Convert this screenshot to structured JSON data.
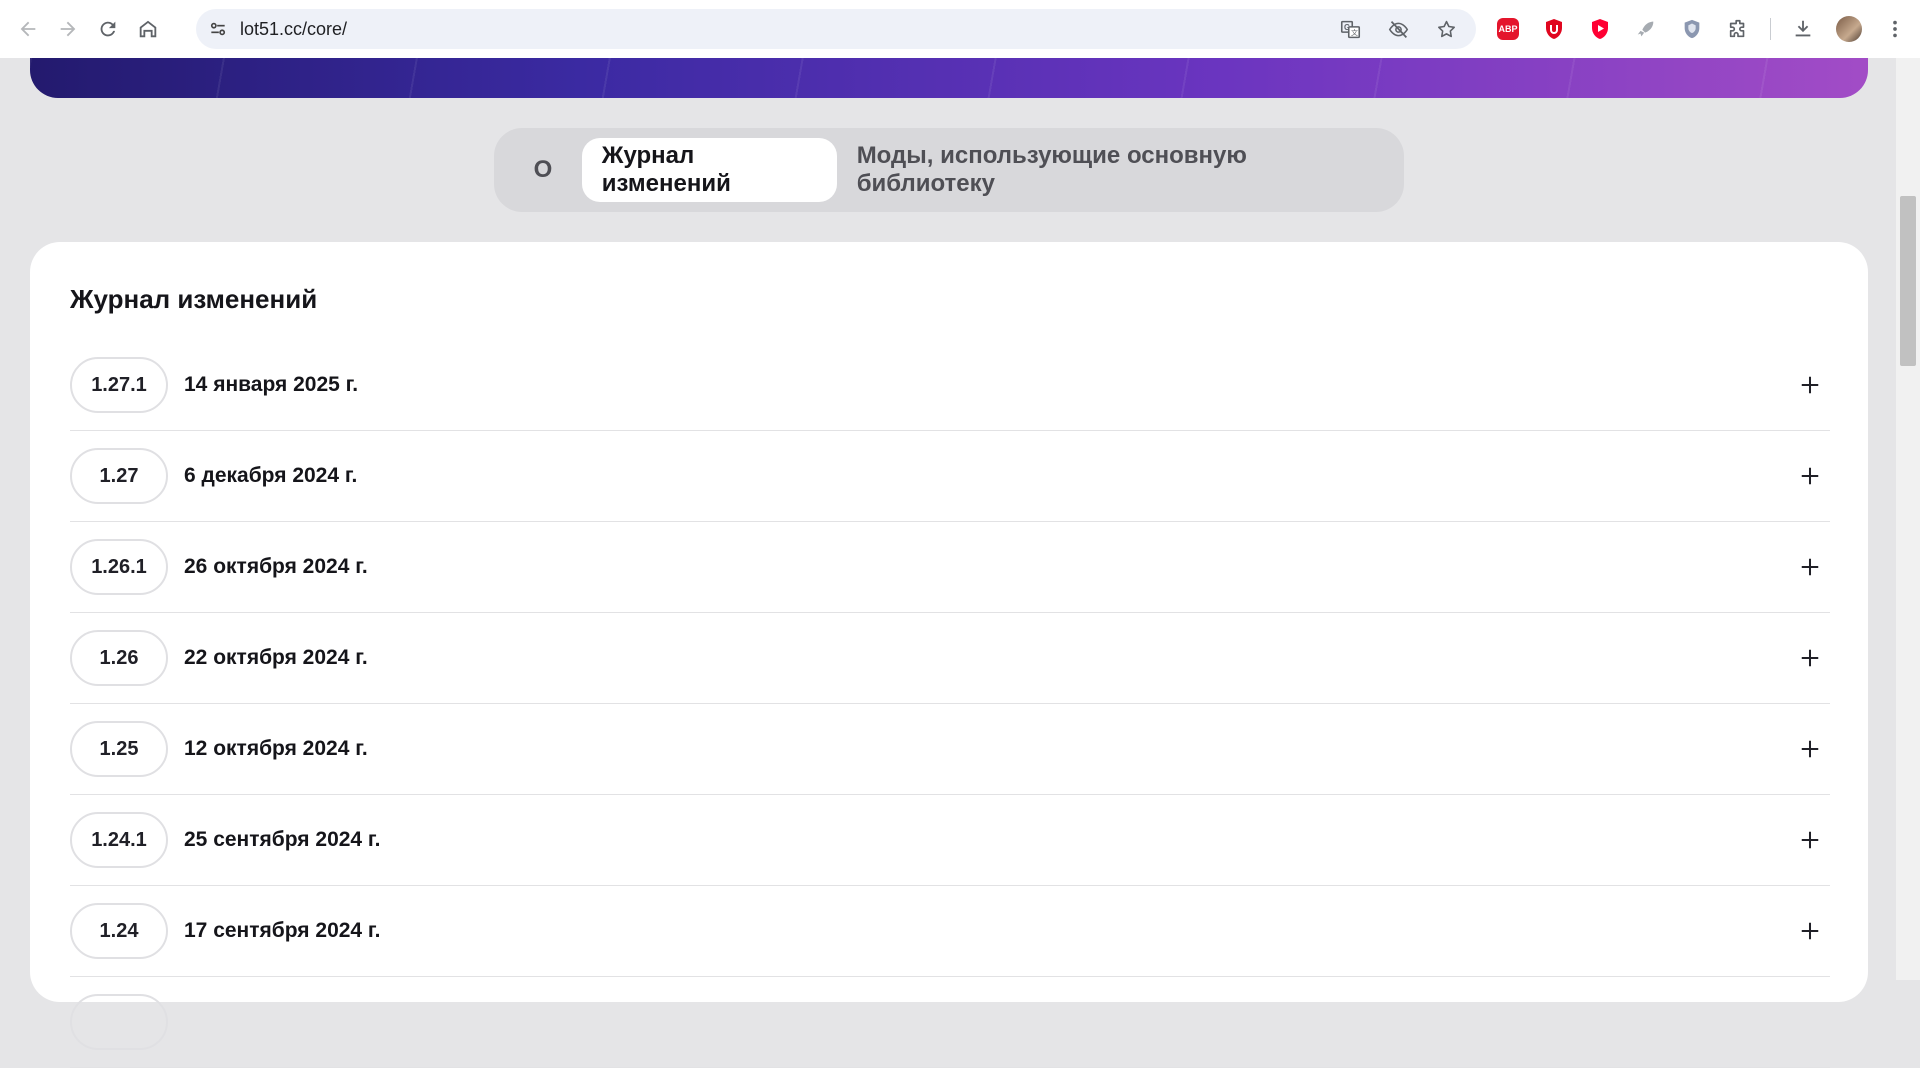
{
  "browser": {
    "url": "lot51.cc/core/",
    "icons": [
      "back-arrow-icon",
      "forward-arrow-icon",
      "reload-icon",
      "home-icon",
      "site-settings-icon",
      "translate-icon",
      "eye-off-icon",
      "star-icon",
      "extensions-icon",
      "download-icon"
    ],
    "extensions": [
      {
        "name": "adblock-plus",
        "label": "ABP",
        "color": "#e4152c"
      },
      {
        "name": "ublock",
        "label": "",
        "color": "#e0061f"
      },
      {
        "name": "youtube",
        "label": "",
        "color": "#ff0033"
      },
      {
        "name": "rocket",
        "label": "",
        "color": "#9ea3a8"
      },
      {
        "name": "shield",
        "label": "",
        "color": "#8b97b0"
      }
    ]
  },
  "tabs": {
    "about": "О",
    "changelog": "Журнал изменений",
    "mods": "Моды, использующие основную библиотеку"
  },
  "changelog": {
    "title": "Журнал изменений",
    "entries": [
      {
        "version": "1.27.1",
        "date": "14 января 2025 г."
      },
      {
        "version": "1.27",
        "date": "6 декабря 2024 г."
      },
      {
        "version": "1.26.1",
        "date": "26 октября 2024 г."
      },
      {
        "version": "1.26",
        "date": "22 октября 2024 г."
      },
      {
        "version": "1.25",
        "date": "12 октября 2024 г."
      },
      {
        "version": "1.24.1",
        "date": "25 сентября 2024 г."
      },
      {
        "version": "1.24",
        "date": "17 сентября 2024 г."
      }
    ]
  }
}
